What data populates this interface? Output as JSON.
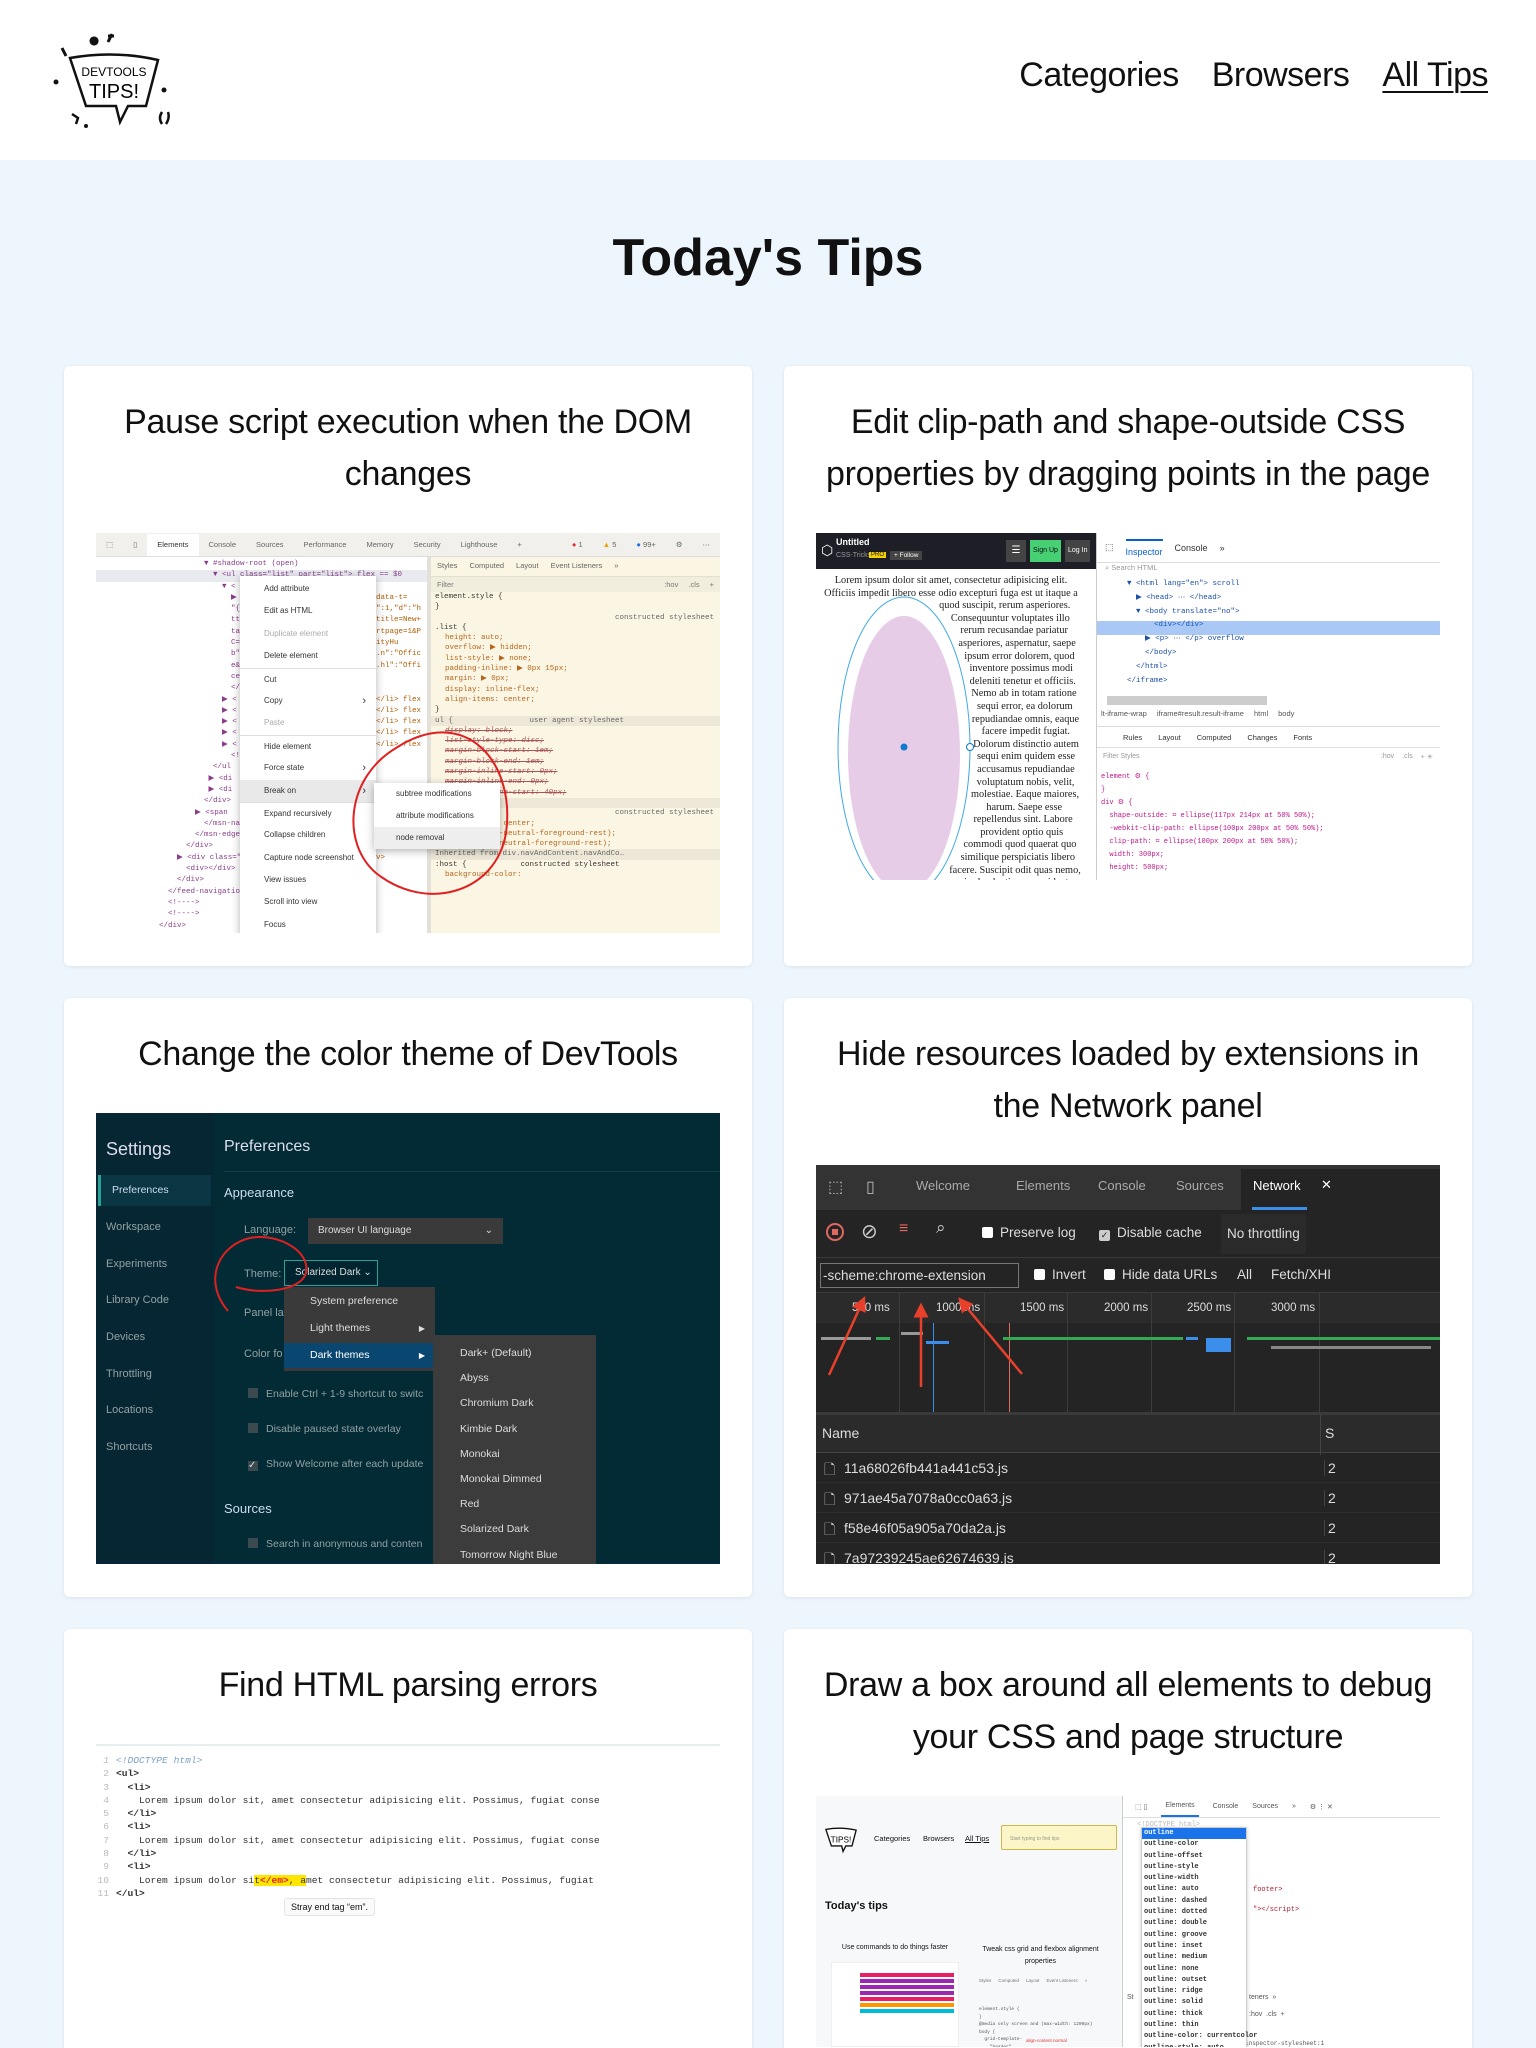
{
  "header": {
    "logo": {
      "line1": "DEVTOOLS",
      "line2": "TIPS!"
    },
    "nav": [
      {
        "label": "Categories"
      },
      {
        "label": "Browsers"
      },
      {
        "label": "All Tips"
      }
    ]
  },
  "page_title": "Today's Tips",
  "cards": [
    {
      "title": "Pause script execution when the DOM changes",
      "shot": {
        "tabs": [
          "Elements",
          "Console",
          "Sources",
          "Performance",
          "Memory",
          "Security",
          "Lighthouse",
          "+"
        ],
        "badges": {
          "errors": "1",
          "warnings": "5",
          "info": "99+"
        },
        "dom_lines": [
          {
            "l": "                        ▼ #shadow-root (open)",
            "r": ""
          },
          {
            "l": "                          ▼ <ul class=\"list\" part=\"list\"> flex == $0",
            "r": ""
          },
          {
            "l": "                            ▼ <",
            "r": ""
          },
          {
            "l": "                              ▶",
            "r": "data-t="
          },
          {
            "l": "                              \"{",
            "r": "\":1,\"d\":\"h"
          },
          {
            "l": "                              tt",
            "r": "title=New+"
          },
          {
            "l": "                              ta",
            "r": "rtpage=1&P"
          },
          {
            "l": "                              C=",
            "r": "ityHu"
          },
          {
            "l": "                              b\"",
            "r": ".n\":\"Offic"
          },
          {
            "l": "                              e&",
            "r": ".hl\":\"Offi"
          },
          {
            "l": "                              ce",
            "r": ""
          },
          {
            "l": "                              </",
            "r": ""
          },
          {
            "l": "                            ▶ <",
            "r": "</li> flex"
          },
          {
            "l": "                            ▶ <",
            "r": "</li> flex"
          },
          {
            "l": "                            ▶ <",
            "r": "</li> flex"
          },
          {
            "l": "                            ▶ <",
            "r": "</li> flex"
          },
          {
            "l": "                            ▶ <",
            "r": "</li> flex"
          },
          {
            "l": "                              <!",
            "r": ""
          },
          {
            "l": "                          </ul",
            "r": ""
          },
          {
            "l": "                         ▶ <di",
            "r": ""
          },
          {
            "l": "                         ▶ <di",
            "r": ""
          },
          {
            "l": "                        </div>",
            "r": ""
          },
          {
            "l": "                      ▶ <span",
            "r": ""
          },
          {
            "l": "                        </msn-na",
            "r": ""
          },
          {
            "l": "                      </msn-edgen",
            "r": ""
          },
          {
            "l": "                    </div>",
            "r": ""
          },
          {
            "l": "                  ▶ <div class=\"",
            "r": "v>"
          },
          {
            "l": "                    <div></div>",
            "r": ""
          },
          {
            "l": "                  </div>",
            "r": ""
          },
          {
            "l": "                </feed-navigation-h",
            "r": ""
          },
          {
            "l": "                <!---->",
            "r": ""
          },
          {
            "l": "                <!---->",
            "r": ""
          },
          {
            "l": "              </div>",
            "r": ""
          }
        ],
        "styles_tabs": [
          "Styles",
          "Computed",
          "Layout",
          "Event Listeners",
          "»"
        ],
        "styles_filter": {
          "placeholder": "Filter",
          "hov": ":hov",
          "cls": ".cls"
        },
        "styles_lines": [
          {
            "text": "element.style {",
            "kind": "selector"
          },
          {
            "text": "}",
            "kind": "selector"
          },
          {
            "text": "constructed stylesheet",
            "kind": "source"
          },
          {
            "text": ".list {",
            "kind": "selector"
          },
          {
            "text": "height: auto;",
            "kind": "decl"
          },
          {
            "text": "overflow: ▶ hidden;",
            "kind": "decl"
          },
          {
            "text": "list-style: ▶ none;",
            "kind": "decl"
          },
          {
            "text": "padding-inline: ▶ 0px 15px;",
            "kind": "decl"
          },
          {
            "text": "margin: ▶ 0px;",
            "kind": "decl"
          },
          {
            "text": "display: inline-flex;",
            "kind": "decl"
          },
          {
            "text": "align-items: center;",
            "kind": "decl"
          },
          {
            "text": "}",
            "kind": "selector"
          },
          {
            "text": "ul {                 user agent stylesheet",
            "kind": "meta"
          },
          {
            "text": "display: block;",
            "kind": "struck"
          },
          {
            "text": "list-style-type: disc;",
            "kind": "struck"
          },
          {
            "text": "margin-block-start: 1em;",
            "kind": "struck"
          },
          {
            "text": "margin-block-end: 1em;",
            "kind": "struck"
          },
          {
            "text": "margin-inline-start: 0px;",
            "kind": "struck"
          },
          {
            "text": "margin-inline-end: 0px;",
            "kind": "struck"
          },
          {
            "text": "padding-inline-start: 40px;",
            "kind": "struck"
          },
          {
            "text": "-root (open)",
            "kind": "meta"
          },
          {
            "text": "constructed stylesheet",
            "kind": "source"
          },
          {
            "text": "align-items: center;",
            "kind": "decl"
          },
          {
            "text": "color: var(--neutral-foreground-rest);",
            "kind": "decl"
          },
          {
            "text": "fill: var(--neutral-foreground-rest);",
            "kind": "decl"
          },
          {
            "text": "Inherited from div.navAndContent.navAndCo…",
            "kind": "meta"
          },
          {
            "text": ":host {            constructed stylesheet",
            "kind": "selector"
          },
          {
            "text": "background-color:",
            "kind": "decl"
          }
        ],
        "context_menu": [
          {
            "text": "Add attribute",
            "kind": "normal"
          },
          {
            "text": "Edit as HTML",
            "kind": "normal"
          },
          {
            "text": "Duplicate element",
            "kind": "disabled"
          },
          {
            "text": "Delete element",
            "kind": "normal"
          },
          {
            "text": "Cut",
            "kind": "sep"
          },
          {
            "text": "Copy",
            "kind": "sub"
          },
          {
            "text": "Paste",
            "kind": "disabled"
          },
          {
            "text": "Hide element",
            "kind": "sep"
          },
          {
            "text": "Force state",
            "kind": "sub"
          },
          {
            "text": "Break on",
            "kind": "active"
          },
          {
            "text": "Expand recursively",
            "kind": "sep"
          },
          {
            "text": "Collapse children",
            "kind": "normal"
          },
          {
            "text": "Capture node screenshot",
            "kind": "normal"
          },
          {
            "text": "View issues",
            "kind": "normal"
          },
          {
            "text": "Scroll into view",
            "kind": "normal"
          },
          {
            "text": "Focus",
            "kind": "normal"
          }
        ],
        "break_on_submenu": [
          {
            "text": "subtree modifications"
          },
          {
            "text": "attribute modifications"
          },
          {
            "text": "node removal"
          }
        ]
      }
    },
    {
      "title": "Edit clip-path and shape-outside CSS properties by dragging points in the page",
      "shot": {
        "pen_title": "Untitled",
        "pen_author": "CSS-Tricks",
        "pro_badge": "PRO",
        "follow": "+ Follow",
        "sign_up": "Sign Up",
        "log_in": "Log In",
        "preview_text": "Lorem ipsum dolor sit amet, consectetur adipisicing elit. Officiis impedit libero esse odio excepturi fuga est ut itaque a quod suscipit, rerum asperiores. Consequuntur voluptates illo rerum recusandae pariatur asperiores, aspernatur, saepe ipsum error dolorem, quod inventore possimus modi deleniti tenetur et officiis. Nemo ab in totam ratione sequi error, ea dolorum repudiandae omnis, eaque facere impedit fugiat. Dolorum distinctio autem sequi enim quidem esse accusamus repudiandae voluptatum nobis, velit, molestiae. Eaque maiores, harum. Saepe esse repellendus sint. Labore provident optio quis commodi quod quaerat quo similique perspiciatis libero facere. Suscipit odit quas nemo, enim laudantium, provident repellendus natus nostrum facilis expedita adipisci qui, harum minus",
        "tabs": [
          "Inspector",
          "Console",
          "»"
        ],
        "search_placeholder": "Search HTML",
        "tree": [
          "▼ <html lang=\"en\"> scroll",
          "  ▶ <head> ⋯ </head>",
          "  ▼ <body translate=\"no\">",
          "      <div></div>",
          "    ▶ <p> ⋯ </p> overflow",
          "    </body>",
          "  </html>",
          "</iframe>"
        ],
        "breadcrumb": [
          "lt-iframe-wrap",
          "iframe#result.result-iframe",
          "html",
          "body"
        ],
        "rules_tabs": [
          "Rules",
          "Layout",
          "Computed",
          "Changes",
          "Fonts"
        ],
        "filter_placeholder": "Filter Styles",
        "hov": ":hov",
        "cls": ".cls",
        "rules": [
          "element ⚙ {",
          "}",
          "div ⚙ {",
          "  shape-outside: ⌗ ellipse(117px 214px at 50% 50%);",
          "  -webkit-clip-path: ellipse(100px 200px at 50% 50%);",
          "  clip-path: ⌗ ellipse(100px 200px at 50% 50%);",
          "  width: 300px;",
          "  height: 500px;"
        ]
      }
    },
    {
      "title": "Change the color theme of DevTools",
      "shot": {
        "settings_title": "Settings",
        "sidebar": [
          "Preferences",
          "Workspace",
          "Experiments",
          "Library Code",
          "Devices",
          "Throttling",
          "Locations",
          "Shortcuts"
        ],
        "pane_title": "Preferences",
        "appearance": "Appearance",
        "language_label": "Language:",
        "language_value": "Browser UI language",
        "theme_label": "Theme:",
        "theme_value": "Solarized Dark",
        "panel_layout_label": "Panel lay",
        "color_format_label": "Color fo",
        "checkboxes": [
          {
            "label": "Enable Ctrl + 1-9 shortcut to switc",
            "checked": false
          },
          {
            "label": "Disable paused state overlay",
            "checked": false
          },
          {
            "label": "Show Welcome after each update",
            "checked": true
          }
        ],
        "sources": "Sources",
        "sources_checkbox": "Search in anonymous and conten",
        "theme_menu": [
          {
            "text": "System preference",
            "kind": "normal"
          },
          {
            "text": "Light themes",
            "kind": "sub"
          },
          {
            "text": "Dark themes",
            "kind": "active sub"
          }
        ],
        "dark_themes": [
          "Dark+ (Default)",
          "Abyss",
          "Chromium Dark",
          "Kimbie Dark",
          "Monokai",
          "Monokai Dimmed",
          "Red",
          "Solarized Dark",
          "Tomorrow Night Blue"
        ]
      }
    },
    {
      "title": "Hide resources loaded by extensions in the Network panel",
      "shot": {
        "tabs": [
          "Welcome",
          "Elements",
          "Console",
          "Sources",
          "Network"
        ],
        "preserve_log": "Preserve log",
        "disable_cache": "Disable cache",
        "throttling": "No throttling",
        "filter_value": "-scheme:chrome-extension",
        "invert": "Invert",
        "hide_data_urls": "Hide data URLs",
        "all": "All",
        "fetch_xhr": "Fetch/XHI",
        "ruler": [
          "500 ms",
          "1000 ms",
          "1500 ms",
          "2000 ms",
          "2500 ms",
          "3000 ms"
        ],
        "name_header": "Name",
        "status_header": "S",
        "rows": [
          {
            "name": "11a68026fb441a441c53.js",
            "status": "2"
          },
          {
            "name": "971ae45a7078a0cc0a63.js",
            "status": "2"
          },
          {
            "name": "f58e46f05a905a70da2a.js",
            "status": "2"
          },
          {
            "name": "7a97239245ae62674639.js",
            "status": "2"
          }
        ]
      }
    },
    {
      "title": "Find HTML parsing errors",
      "shot": {
        "lines": [
          {
            "n": "1",
            "text": "<!DOCTYPE html>"
          },
          {
            "n": "2",
            "text": "<ul>"
          },
          {
            "n": "3",
            "text": "  <li>"
          },
          {
            "n": "4",
            "text": "    Lorem ipsum dolor sit, amet consectetur adipisicing elit. Possimus, fugiat conse"
          },
          {
            "n": "5",
            "text": "  </li>"
          },
          {
            "n": "6",
            "text": "  <li>"
          },
          {
            "n": "7",
            "text": "    Lorem ipsum dolor sit, amet consectetur adipisicing elit. Possimus, fugiat conse"
          },
          {
            "n": "8",
            "text": "  </li>"
          },
          {
            "n": "9",
            "text": "  <li>"
          },
          {
            "n": "10",
            "pre": "    Lorem ipsum dolor si",
            "hl_a": "t",
            "err": "</em>",
            "hl_b": ", a",
            "post": "met consectetur adipisicing elit. Possimus, fugiat"
          },
          {
            "n": "11",
            "text": "</ul>"
          }
        ],
        "tooltip": "Stray end tag “em”."
      }
    },
    {
      "title": "Draw a box around all elements to debug your CSS and page structure",
      "shot": {
        "nav": [
          "Categories",
          "Browsers",
          "All Tips"
        ],
        "search_placeholder": "Start typing to find tips",
        "heading": "Today's tips",
        "mini_cards": [
          "Use commands to do things faster",
          "Tweak css grid and flexbox alignment properties"
        ],
        "mini_styles": [
          "Styles",
          "Computed",
          "Layout",
          "Event Listeners",
          "»"
        ],
        "mini_css": [
          "element.style {",
          "}",
          "@media only screen and (max-width: 1200px)",
          "body {",
          "  grid-template-",
          "    \"header\""
        ],
        "mini_align": "align-content normal",
        "devtools_tabs": [
          "Elements",
          "Console",
          "Sources",
          "»"
        ],
        "dom_fragments": [
          "<!DOCTYPE html>",
          "footer>",
          "\"></script>"
        ],
        "styles_tab": "St",
        "listeners": "teners  »",
        "hov_cls": ":hov  .cls  +",
        "stylesheet": "inspector-stylesheet:1",
        "autocomplete": [
          {
            "text": "outline",
            "kind": "active"
          },
          {
            "text": "outline-color"
          },
          {
            "text": "outline-offset"
          },
          {
            "text": "outline-style"
          },
          {
            "text": "outline-width"
          },
          {
            "text": "outline: auto"
          },
          {
            "text": "outline: dashed"
          },
          {
            "text": "outline: dotted"
          },
          {
            "text": "outline: double"
          },
          {
            "text": "outline: groove"
          },
          {
            "text": "outline: inset"
          },
          {
            "text": "outline: medium"
          },
          {
            "text": "outline: none"
          },
          {
            "text": "outline: outset"
          },
          {
            "text": "outline: ridge"
          },
          {
            "text": "outline: solid"
          },
          {
            "text": "outline: thick"
          },
          {
            "text": "outline: thin"
          },
          {
            "text": "outline-color: currentcolor"
          },
          {
            "text": "outline-style: auto"
          }
        ]
      }
    }
  ],
  "colors": {
    "page_bg": "#eef6fd",
    "annotation_red": "#e02020",
    "link_blue": "#1a73e8"
  }
}
